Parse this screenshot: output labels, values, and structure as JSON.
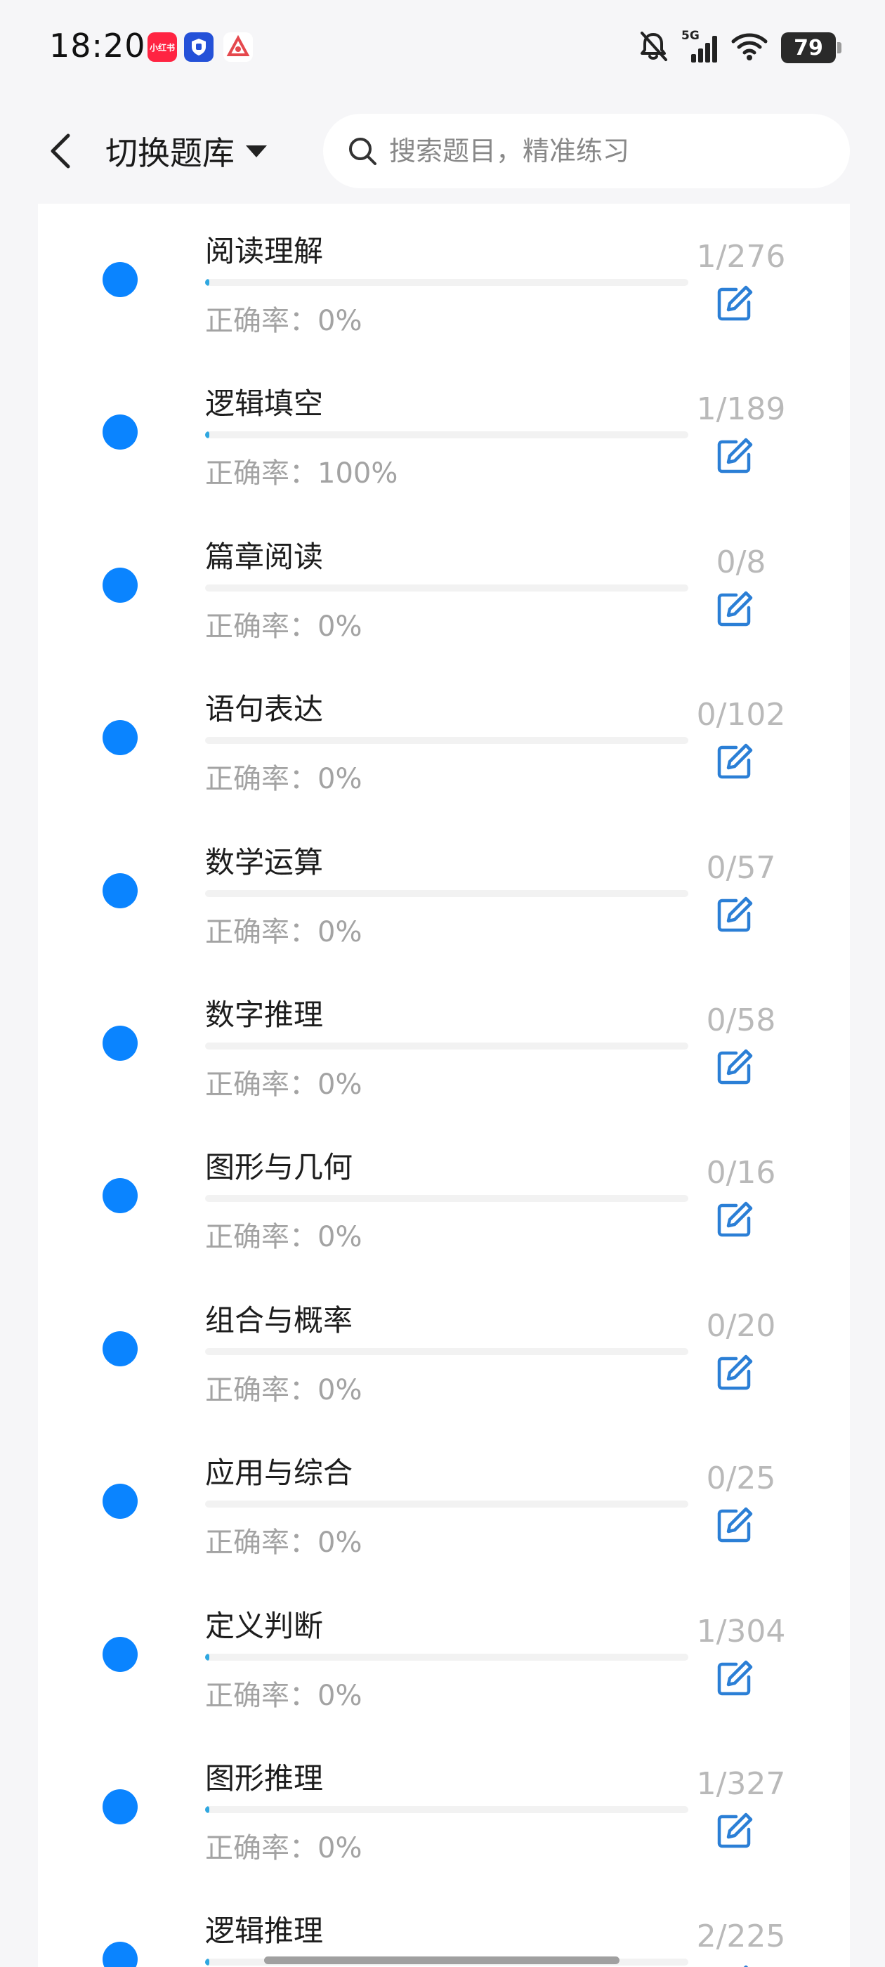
{
  "status_bar": {
    "time": "18:20",
    "notifications": [
      {
        "icon": "xiaohongshu-app-icon",
        "label": "小红书"
      },
      {
        "icon": "shield-app-icon",
        "label": "天眼"
      },
      {
        "icon": "triangle-app-icon",
        "label": ""
      }
    ],
    "network": "5G",
    "battery": "79"
  },
  "header": {
    "switch_label": "切换题库",
    "search_placeholder": "搜索题目，精准练习"
  },
  "accuracy_prefix": "正确率：",
  "colors": {
    "accent": "#0a84ff",
    "progress": "#2fa7e0",
    "edit_icon": "#2b7fd6"
  },
  "categories": [
    {
      "title": "阅读理解",
      "accuracy": "正确率：0%",
      "count": "1/276",
      "progress": 0.004
    },
    {
      "title": "逻辑填空",
      "accuracy": "正确率：100%",
      "count": "1/189",
      "progress": 0.005
    },
    {
      "title": "篇章阅读",
      "accuracy": "正确率：0%",
      "count": "0/8",
      "progress": 0
    },
    {
      "title": "语句表达",
      "accuracy": "正确率：0%",
      "count": "0/102",
      "progress": 0
    },
    {
      "title": "数学运算",
      "accuracy": "正确率：0%",
      "count": "0/57",
      "progress": 0
    },
    {
      "title": "数字推理",
      "accuracy": "正确率：0%",
      "count": "0/58",
      "progress": 0
    },
    {
      "title": "图形与几何",
      "accuracy": "正确率：0%",
      "count": "0/16",
      "progress": 0
    },
    {
      "title": "组合与概率",
      "accuracy": "正确率：0%",
      "count": "0/20",
      "progress": 0
    },
    {
      "title": "应用与综合",
      "accuracy": "正确率：0%",
      "count": "0/25",
      "progress": 0
    },
    {
      "title": "定义判断",
      "accuracy": "正确率：0%",
      "count": "1/304",
      "progress": 0.003
    },
    {
      "title": "图形推理",
      "accuracy": "正确率：0%",
      "count": "1/327",
      "progress": 0.003
    },
    {
      "title": "逻辑推理",
      "accuracy": "",
      "count": "2/225",
      "progress": 0.009
    }
  ]
}
